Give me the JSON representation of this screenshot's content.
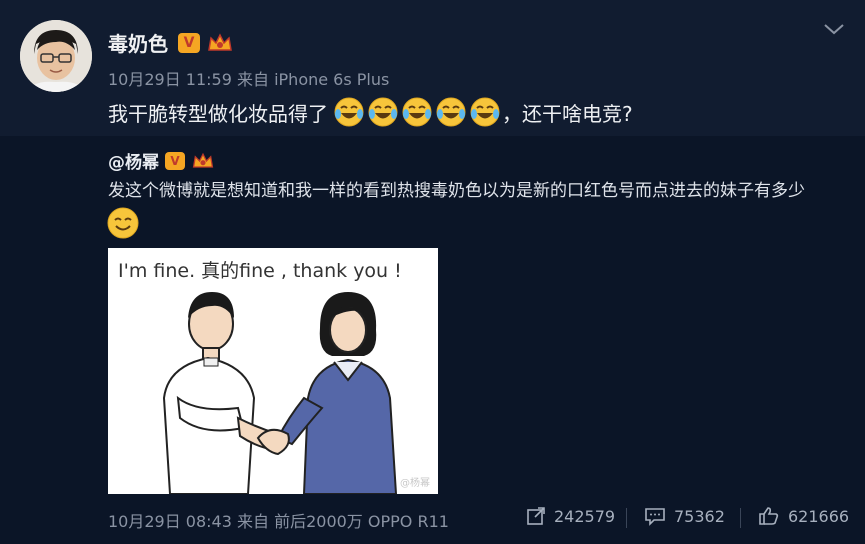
{
  "post": {
    "author": "毒奶色",
    "meta": "10月29日 11:59 来自 iPhone 6s Plus",
    "text_before": "我干脆转型做化妆品得了",
    "text_after": "，还干啥电竞?",
    "emoji_icon": "crying-laughing-icon",
    "emoji_count": 5
  },
  "repost": {
    "author": "@杨幂",
    "text": "发这个微博就是想知道和我一样的看到热搜毒奶色以为是新的口红色号而点进去的妹子有多少",
    "image_caption": "I'm fine. 真的fine , thank you !",
    "image_watermark": "@杨幂"
  },
  "footer": {
    "meta": "10月29日 08:43 来自 前后2000万 OPPO R11",
    "repost_count": "242579",
    "comment_count": "75362",
    "like_count": "621666"
  },
  "colors": {
    "background": "#0b1527",
    "header_background": "#111c30",
    "badge": "#f5a623"
  }
}
